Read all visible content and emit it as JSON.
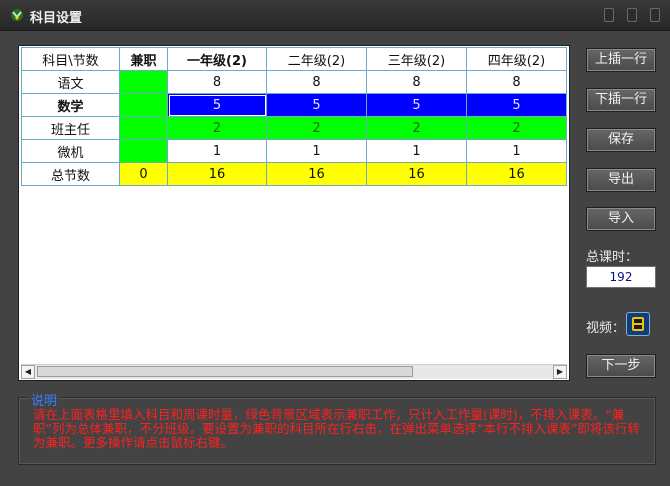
{
  "window": {
    "title": "科目设置"
  },
  "table": {
    "headers": [
      "科目\\节数",
      "兼职",
      "一年级(2)",
      "二年级(2)",
      "三年级(2)",
      "四年级(2)"
    ],
    "rows": [
      {
        "subject": "语文",
        "jianzhi": "",
        "values": [
          "8",
          "8",
          "8",
          "8"
        ]
      },
      {
        "subject": "数学",
        "jianzhi": "",
        "values": [
          "5",
          "5",
          "5",
          "5"
        ]
      },
      {
        "subject": "班主任",
        "jianzhi": "",
        "values": [
          "2",
          "2",
          "2",
          "2"
        ]
      },
      {
        "subject": "微机",
        "jianzhi": "",
        "values": [
          "1",
          "1",
          "1",
          "1"
        ]
      },
      {
        "subject": "总节数",
        "jianzhi": "0",
        "values": [
          "16",
          "16",
          "16",
          "16"
        ]
      }
    ]
  },
  "buttons": {
    "insert_above": "上插一行",
    "insert_below": "下插一行",
    "save": "保存",
    "export": "导出",
    "import": "导入",
    "next": "下一步"
  },
  "total_hours": {
    "label": "总课时：",
    "value": "192"
  },
  "video": {
    "label": "视频："
  },
  "notes": {
    "title": "说明",
    "text": "请在上面表格里填入科目和周课时量，绿色背景区域表示兼职工作，只计入工作量(课时)，不排入课表。“兼职”列为总体兼职，不分班级。要设置为兼职的科目所在行右击，在弹出菜单选择“本行不排入课表”即将该行转为兼职。更多操作请点击鼠标右键。"
  },
  "colors": {
    "blue_row": "#0000ff",
    "green": "#00ff00",
    "yellow": "#ffff00",
    "notes_text": "#ff2020",
    "notes_title": "#3b7cff"
  },
  "icons": [
    "app-icon",
    "minimize-icon",
    "maximize-icon",
    "close-icon",
    "scroll-left-icon",
    "scroll-right-icon",
    "video-icon"
  ]
}
